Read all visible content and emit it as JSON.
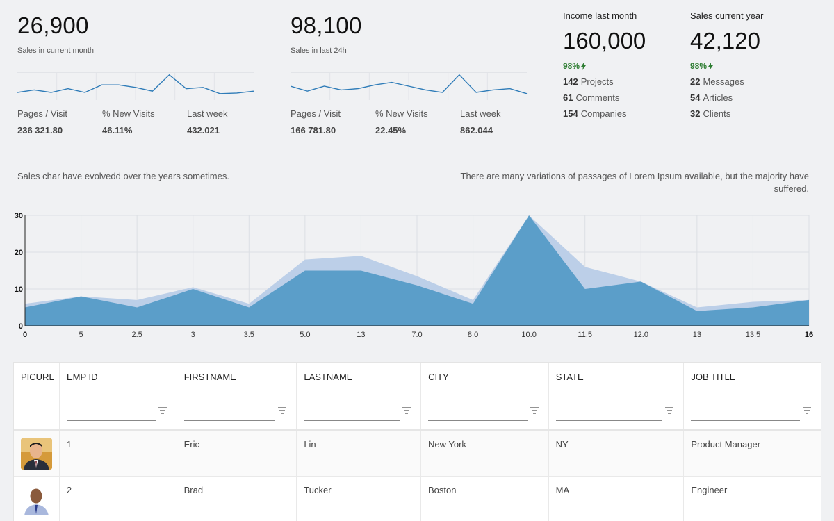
{
  "kpi_left": {
    "value": "26,900",
    "subtitle": "Sales in current month",
    "metrics": [
      {
        "label": "Pages / Visit",
        "value": "236 321.80"
      },
      {
        "label": "% New Visits",
        "value": "46.11%"
      },
      {
        "label": "Last week",
        "value": "432.021"
      }
    ]
  },
  "kpi_mid": {
    "value": "98,100",
    "subtitle": "Sales in last 24h",
    "metrics": [
      {
        "label": "Pages / Visit",
        "value": "166 781.80"
      },
      {
        "label": "% New Visits",
        "value": "22.45%"
      },
      {
        "label": "Last week",
        "value": "862.044"
      }
    ]
  },
  "income": {
    "title": "Income last month",
    "value": "160,000",
    "percent": "98%",
    "rows": [
      {
        "count": "142",
        "label": "Projects"
      },
      {
        "count": "61",
        "label": "Comments"
      },
      {
        "count": "154",
        "label": "Companies"
      }
    ]
  },
  "sales_year": {
    "title": "Sales current year",
    "value": "42,120",
    "percent": "98%",
    "rows": [
      {
        "count": "22",
        "label": "Messages"
      },
      {
        "count": "54",
        "label": "Articles"
      },
      {
        "count": "32",
        "label": "Clients"
      }
    ]
  },
  "description_left": "Sales char have evolvedd over the years sometimes.",
  "description_right_line1": "There are many variations of passages of Lorem Ipsum available, but the majority have",
  "description_right_line2": "suffered.",
  "colors": {
    "spark_line": "#2f7cb8",
    "area_front": "#5b9ec9",
    "area_back": "#bccfe8",
    "positive": "#2e7d32"
  },
  "chart_data": [
    {
      "type": "line",
      "series": [
        {
          "values": [
            5,
            7,
            5,
            8,
            5,
            11,
            11,
            9,
            6,
            19,
            8,
            9,
            4,
            4.5,
            6
          ]
        }
      ],
      "ylim": [
        0,
        20
      ]
    },
    {
      "type": "line",
      "series": [
        {
          "values": [
            10,
            6,
            10,
            7,
            8,
            11,
            13,
            10,
            7,
            5,
            19,
            5,
            7,
            8,
            4
          ]
        }
      ],
      "ylim": [
        0,
        20
      ]
    },
    {
      "type": "area",
      "categories": [
        "0",
        "5",
        "2.5",
        "3",
        "3.5",
        "5.0",
        "13",
        "7.0",
        "8.0",
        "10.0",
        "11.5",
        "12.0",
        "13",
        "13.5",
        "16"
      ],
      "series": [
        {
          "values": [
            6,
            8,
            7,
            10.5,
            6,
            18,
            19,
            13.5,
            7,
            30,
            16,
            12,
            5,
            6.5,
            7
          ]
        },
        {
          "values": [
            5,
            8,
            5,
            10,
            5,
            15,
            15,
            11,
            6,
            30,
            10,
            12,
            4,
            5,
            7
          ]
        }
      ],
      "yticks": [
        "0",
        "10",
        "20",
        "30"
      ],
      "ylim": [
        0,
        30
      ]
    }
  ],
  "table": {
    "columns": [
      "PICURL",
      "EMP ID",
      "FIRSTNAME",
      "LASTNAME",
      "CITY",
      "STATE",
      "JOB TITLE"
    ],
    "rows": [
      {
        "id": "1",
        "first": "Eric",
        "last": "Lin",
        "city": "New York",
        "state": "NY",
        "title": "Product Manager"
      },
      {
        "id": "2",
        "first": "Brad",
        "last": "Tucker",
        "city": "Boston",
        "state": "MA",
        "title": "Engineer"
      }
    ]
  }
}
